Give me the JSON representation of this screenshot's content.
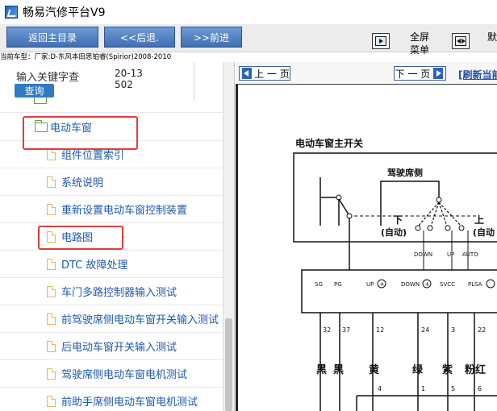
{
  "window": {
    "title": "畅易汽修平台V9"
  },
  "toolbar": {
    "home_label": "返回主目录",
    "back_label": "<<后退.",
    "forward_label": ">>前进",
    "fullscreen_label": "全屏\n菜单",
    "split_label": "默认"
  },
  "vehicle": {
    "info": "当前车型：厂家:D-东风本田思铂睿(Spirior)2008-2010"
  },
  "search": {
    "label": "输入关键字查",
    "value": "20-13502",
    "button_label": "查询"
  },
  "tree": {
    "folder": {
      "label": "电动车窗",
      "icon": "folder-open-icon"
    },
    "items": [
      {
        "label": "组件位置索引"
      },
      {
        "label": "系统说明"
      },
      {
        "label": "重新设置电动车窗控制装置"
      },
      {
        "label": "电路图"
      },
      {
        "label": "DTC 故障处理"
      },
      {
        "label": "车门多路控制器输入测试"
      },
      {
        "label": "前驾驶席侧电动车窗开关输入测试"
      },
      {
        "label": "后电动车窗开关输入测试"
      },
      {
        "label": "驾驶席侧电动车窗电机测试"
      },
      {
        "label": "前助手席侧电动车窗电机测试"
      }
    ],
    "highlighted": [
      "电动车窗",
      "电路图"
    ]
  },
  "viewer": {
    "prev_label": "上 一 页",
    "next_label": "下 一 页",
    "refresh_label": "[刷新当前"
  },
  "diagram": {
    "title": "电动车窗主开关",
    "switch_group_label": "驾驶席侧",
    "down_label": "下",
    "down_sub": "(自动)",
    "up_label": "上",
    "up_sub": "(自动",
    "state_labels": [
      "DOWN",
      "UP",
      "AUTO"
    ],
    "pin_labels": [
      "SG",
      "PG",
      "UP",
      "DOWN",
      "SVCC",
      "PLSA"
    ],
    "pin_numbers": [
      "32",
      "37",
      "12",
      "24",
      "3",
      "22"
    ],
    "wire_colors": [
      "黑",
      "黑",
      "黄",
      "绿",
      "紫",
      "粉红"
    ],
    "connector_numbers": [
      "4",
      "1",
      "5",
      "6"
    ]
  },
  "colors": {
    "accent": "#3f6fb3",
    "highlight": "#e23b3b",
    "link": "#1e5aa8"
  }
}
